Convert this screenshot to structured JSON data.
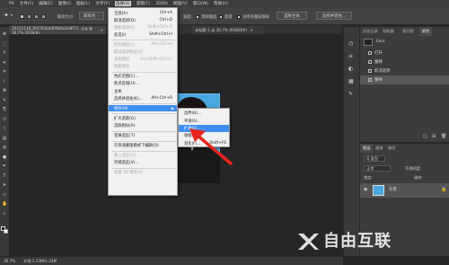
{
  "menubar": {
    "items": [
      "PS",
      "文件(F)",
      "编辑(E)",
      "图像(I)",
      "图层(L)",
      "文字(Y)",
      "选择(S)",
      "滤镜(T)",
      "3D(D)",
      "视图(V)",
      "窗口(W)",
      "帮助(H)"
    ],
    "active_index": 6
  },
  "options": {
    "tool_icon": "magic-wand-icon",
    "sample_label": "取样大小:",
    "sample_value": "取样点",
    "tolerance_label": "容差:",
    "antialias_label": "消除锯齿",
    "contiguous_label": "连续",
    "all_layers_label": "对所有图层取样",
    "subject_button": "选择主体",
    "select_mask_button": "选择并遮住..."
  },
  "doc_tabs": [
    "20211118_0f4762b4d09b4e2e8f72...jpg @ 36.7% (RGB/8)",
    "未标题-1 @ 36.7% (RGB/8#)"
  ],
  "status": {
    "zoom": "36.7%",
    "doc_info": "文档:1.33M/1.33M"
  },
  "history_panel": {
    "tabs": [
      "历史记录",
      "导航器",
      "直方图",
      "颜色"
    ],
    "file_name": "Ears",
    "items": [
      "打开",
      "魔棒",
      "取消选择",
      "魔棒"
    ],
    "selected_index": 3
  },
  "layers_panel": {
    "tabs": [
      "图层",
      "通道",
      "路径"
    ],
    "kind_label": "Q 类型",
    "blend_mode": "正常",
    "opacity_label": "不透明度:",
    "fill_label": "填充:",
    "lock_label": "锁定:",
    "layer_name": "背景"
  },
  "select_menu": {
    "items": [
      {
        "label": "全部(A)",
        "shortcut": "Ctrl+A",
        "state": "enabled"
      },
      {
        "label": "取消选择(D)",
        "shortcut": "Ctrl+D",
        "state": "enabled"
      },
      {
        "label": "重新选择(E)",
        "shortcut": "Shift+Ctrl+D",
        "state": "disabled"
      },
      {
        "label": "反选(I)",
        "shortcut": "Shift+Ctrl+I",
        "state": "enabled"
      },
      {
        "label": "所有图层(L)",
        "shortcut": "Alt+Ctrl+A",
        "state": "disabled"
      },
      {
        "label": "取消选择图层(S)",
        "shortcut": "",
        "state": "disabled"
      },
      {
        "label": "查找图层",
        "shortcut": "Alt+Shift+Ctrl+F",
        "state": "disabled"
      },
      {
        "label": "隔离图层",
        "shortcut": "",
        "state": "disabled"
      },
      {
        "label": "色彩范围(C)...",
        "shortcut": "",
        "state": "enabled"
      },
      {
        "label": "焦点区域(U)...",
        "shortcut": "",
        "state": "enabled"
      },
      {
        "label": "主体",
        "shortcut": "",
        "state": "enabled"
      },
      {
        "label": "选择并遮住(K)...",
        "shortcut": "Alt+Ctrl+R",
        "state": "enabled"
      },
      {
        "label": "修改(M)",
        "shortcut": "",
        "state": "highlighted"
      },
      {
        "label": "扩大选取(G)",
        "shortcut": "",
        "state": "enabled"
      },
      {
        "label": "选取相似(R)",
        "shortcut": "",
        "state": "enabled"
      },
      {
        "label": "变换选区(T)",
        "shortcut": "",
        "state": "enabled"
      },
      {
        "label": "在快速蒙版模式下编辑(Q)",
        "shortcut": "",
        "state": "enabled"
      },
      {
        "label": "载入选区(O)...",
        "shortcut": "",
        "state": "disabled"
      },
      {
        "label": "存储选区(V)...",
        "shortcut": "",
        "state": "enabled"
      },
      {
        "label": "新建 3D 模型(3)",
        "shortcut": "",
        "state": "disabled"
      }
    ]
  },
  "modify_submenu": {
    "items": [
      {
        "label": "边界(B)...",
        "shortcut": "",
        "state": "enabled"
      },
      {
        "label": "平滑(S)...",
        "shortcut": "",
        "state": "enabled"
      },
      {
        "label": "扩展(E)...",
        "shortcut": "",
        "state": "highlighted"
      },
      {
        "label": "收缩(C)...",
        "shortcut": "",
        "state": "enabled"
      },
      {
        "label": "羽化(F)...",
        "shortcut": "Shift+F6",
        "state": "enabled"
      }
    ]
  },
  "watermark": {
    "text": "自由互联"
  },
  "colors": {
    "accent": "#3f8ef0",
    "arrow": "#e8251f",
    "photo_blue": "#4aa7e0"
  }
}
